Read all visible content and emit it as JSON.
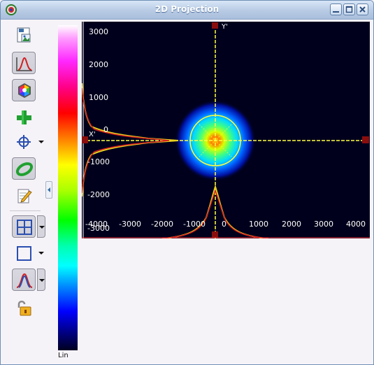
{
  "window": {
    "title": "2D Projection",
    "app_icon": "target-app-icon",
    "controls": [
      "minimize-icon",
      "maximize-icon",
      "close-icon"
    ]
  },
  "toolbar": {
    "items": [
      {
        "name": "save-image-button",
        "icon": "save-image-icon"
      },
      {
        "name": "profile-button",
        "icon": "gaussian-profile-icon",
        "pressed": true
      },
      {
        "name": "color-palette-button",
        "icon": "color-palette-icon",
        "pressed": true
      },
      {
        "name": "add-button",
        "icon": "plus-icon"
      },
      {
        "name": "crosshair-button",
        "icon": "crosshair-icon",
        "dropdown": true
      },
      {
        "name": "ellipse-button",
        "icon": "ellipse-icon",
        "pressed": true
      },
      {
        "name": "notes-button",
        "icon": "notepad-pencil-icon"
      },
      {
        "name": "grid-button",
        "icon": "grid-icon",
        "pressed": true,
        "dropdown": true
      },
      {
        "name": "aperture-button",
        "icon": "square-aperture-icon",
        "dropdown": true
      },
      {
        "name": "fit-button",
        "icon": "gaussian-fit-icon",
        "pressed": true,
        "dropdown": true
      },
      {
        "name": "lock-button",
        "icon": "unlocked-lock-icon"
      }
    ]
  },
  "colorbar": {
    "scale_label": "Lin",
    "palette": "rainbow"
  },
  "plot": {
    "y_ticks": [
      "3000",
      "2000",
      "1000",
      "0",
      "-1000",
      "-2000",
      "-3000"
    ],
    "x_ticks": [
      "-4000",
      "-3000",
      "-2000",
      "-1000",
      "0",
      "1000",
      "2000",
      "3000",
      "4000"
    ],
    "x_axis_label": "X'",
    "y_axis_label": "Y'",
    "background": "#00001c",
    "crosshair_color": "#ffff40",
    "profile_color": "#e8d020",
    "fit_color": "#d02020",
    "handle_color": "#8a0e0e"
  }
}
